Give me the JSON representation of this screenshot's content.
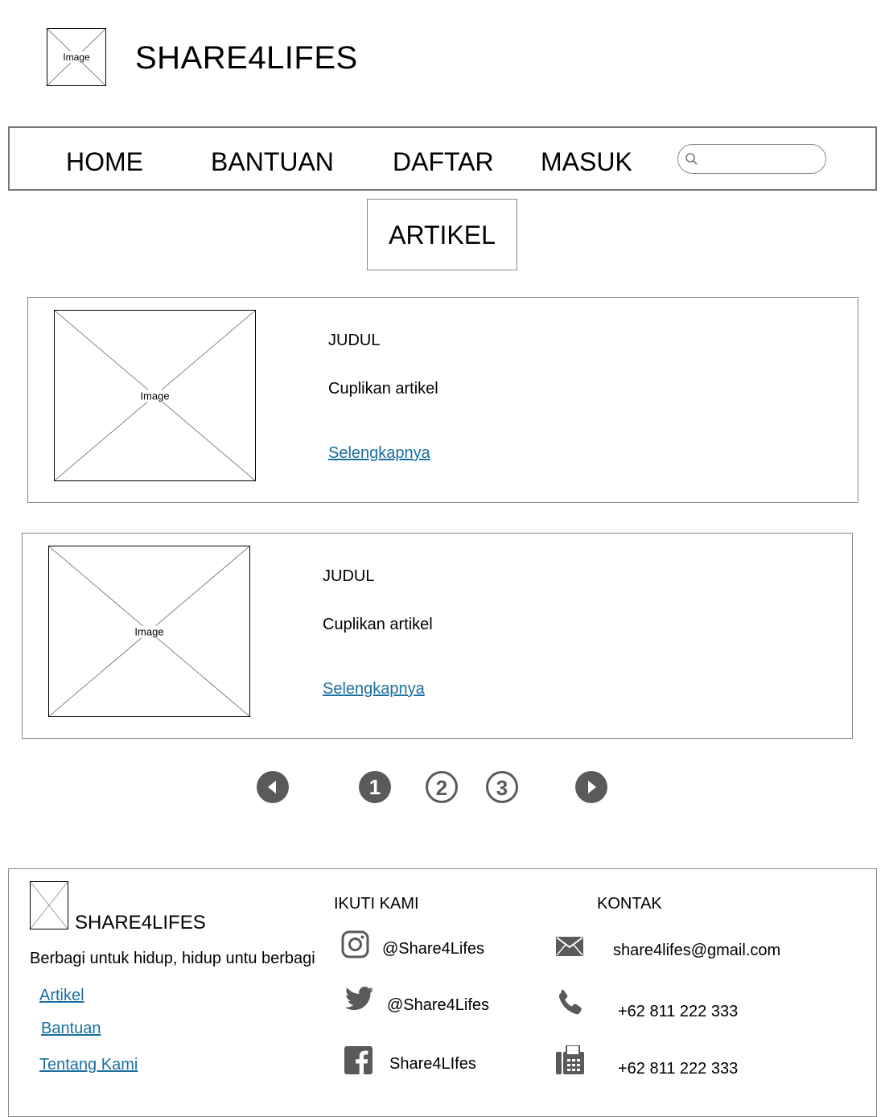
{
  "header": {
    "logo_label": "Image",
    "brand": "SHARE4LIFES"
  },
  "nav": {
    "items": [
      "HOME",
      "BANTUAN",
      "DAFTAR",
      "MASUK"
    ],
    "search_placeholder": ""
  },
  "section": {
    "title": "ARTIKEL"
  },
  "articles": [
    {
      "image_label": "Image",
      "title": "JUDUL",
      "excerpt": "Cuplikan artikel",
      "link": "Selengkapnya"
    },
    {
      "image_label": "Image",
      "title": "JUDUL",
      "excerpt": "Cuplikan artikel",
      "link": "Selengkapnya"
    }
  ],
  "pagination": {
    "pages": [
      "1",
      "2",
      "3"
    ],
    "current": "1",
    "prev_icon": "caret-left-icon",
    "next_icon": "caret-right-icon"
  },
  "footer": {
    "brand": "SHARE4LIFES",
    "tagline": "Berbagi untuk hidup, hidup untu berbagi",
    "links": [
      "Artikel",
      "Bantuan",
      "Tentang Kami"
    ],
    "follow_title": "IKUTI KAMI",
    "social": [
      {
        "icon": "instagram-icon",
        "handle": "@Share4Lifes"
      },
      {
        "icon": "twitter-icon",
        "handle": "@Share4Lifes"
      },
      {
        "icon": "facebook-icon",
        "handle": "Share4LIfes"
      }
    ],
    "contact_title": "KONTAK",
    "contacts": [
      {
        "icon": "mail-icon",
        "value": "share4lifes@gmail.com"
      },
      {
        "icon": "phone-icon",
        "value": "+62 811 222 333"
      },
      {
        "icon": "fax-icon",
        "value": "+62 811 222 333"
      }
    ]
  },
  "colors": {
    "link": "#1a6fa0",
    "icon_gray": "#5a5a5a",
    "border": "#888888"
  }
}
